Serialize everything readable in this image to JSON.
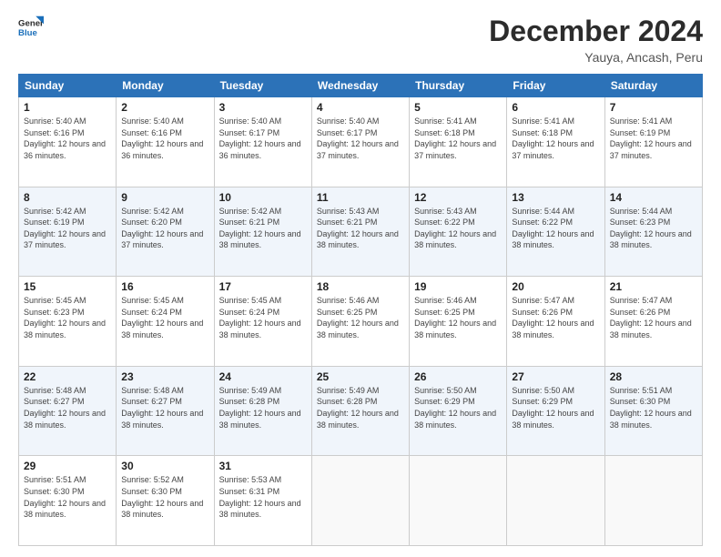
{
  "header": {
    "logo_line1": "General",
    "logo_line2": "Blue",
    "title": "December 2024",
    "subtitle": "Yauya, Ancash, Peru"
  },
  "days_of_week": [
    "Sunday",
    "Monday",
    "Tuesday",
    "Wednesday",
    "Thursday",
    "Friday",
    "Saturday"
  ],
  "weeks": [
    [
      {
        "day": "1",
        "sunrise": "5:40 AM",
        "sunset": "6:16 PM",
        "daylight": "12 hours and 36 minutes."
      },
      {
        "day": "2",
        "sunrise": "5:40 AM",
        "sunset": "6:16 PM",
        "daylight": "12 hours and 36 minutes."
      },
      {
        "day": "3",
        "sunrise": "5:40 AM",
        "sunset": "6:17 PM",
        "daylight": "12 hours and 36 minutes."
      },
      {
        "day": "4",
        "sunrise": "5:40 AM",
        "sunset": "6:17 PM",
        "daylight": "12 hours and 37 minutes."
      },
      {
        "day": "5",
        "sunrise": "5:41 AM",
        "sunset": "6:18 PM",
        "daylight": "12 hours and 37 minutes."
      },
      {
        "day": "6",
        "sunrise": "5:41 AM",
        "sunset": "6:18 PM",
        "daylight": "12 hours and 37 minutes."
      },
      {
        "day": "7",
        "sunrise": "5:41 AM",
        "sunset": "6:19 PM",
        "daylight": "12 hours and 37 minutes."
      }
    ],
    [
      {
        "day": "8",
        "sunrise": "5:42 AM",
        "sunset": "6:19 PM",
        "daylight": "12 hours and 37 minutes."
      },
      {
        "day": "9",
        "sunrise": "5:42 AM",
        "sunset": "6:20 PM",
        "daylight": "12 hours and 37 minutes."
      },
      {
        "day": "10",
        "sunrise": "5:42 AM",
        "sunset": "6:21 PM",
        "daylight": "12 hours and 38 minutes."
      },
      {
        "day": "11",
        "sunrise": "5:43 AM",
        "sunset": "6:21 PM",
        "daylight": "12 hours and 38 minutes."
      },
      {
        "day": "12",
        "sunrise": "5:43 AM",
        "sunset": "6:22 PM",
        "daylight": "12 hours and 38 minutes."
      },
      {
        "day": "13",
        "sunrise": "5:44 AM",
        "sunset": "6:22 PM",
        "daylight": "12 hours and 38 minutes."
      },
      {
        "day": "14",
        "sunrise": "5:44 AM",
        "sunset": "6:23 PM",
        "daylight": "12 hours and 38 minutes."
      }
    ],
    [
      {
        "day": "15",
        "sunrise": "5:45 AM",
        "sunset": "6:23 PM",
        "daylight": "12 hours and 38 minutes."
      },
      {
        "day": "16",
        "sunrise": "5:45 AM",
        "sunset": "6:24 PM",
        "daylight": "12 hours and 38 minutes."
      },
      {
        "day": "17",
        "sunrise": "5:45 AM",
        "sunset": "6:24 PM",
        "daylight": "12 hours and 38 minutes."
      },
      {
        "day": "18",
        "sunrise": "5:46 AM",
        "sunset": "6:25 PM",
        "daylight": "12 hours and 38 minutes."
      },
      {
        "day": "19",
        "sunrise": "5:46 AM",
        "sunset": "6:25 PM",
        "daylight": "12 hours and 38 minutes."
      },
      {
        "day": "20",
        "sunrise": "5:47 AM",
        "sunset": "6:26 PM",
        "daylight": "12 hours and 38 minutes."
      },
      {
        "day": "21",
        "sunrise": "5:47 AM",
        "sunset": "6:26 PM",
        "daylight": "12 hours and 38 minutes."
      }
    ],
    [
      {
        "day": "22",
        "sunrise": "5:48 AM",
        "sunset": "6:27 PM",
        "daylight": "12 hours and 38 minutes."
      },
      {
        "day": "23",
        "sunrise": "5:48 AM",
        "sunset": "6:27 PM",
        "daylight": "12 hours and 38 minutes."
      },
      {
        "day": "24",
        "sunrise": "5:49 AM",
        "sunset": "6:28 PM",
        "daylight": "12 hours and 38 minutes."
      },
      {
        "day": "25",
        "sunrise": "5:49 AM",
        "sunset": "6:28 PM",
        "daylight": "12 hours and 38 minutes."
      },
      {
        "day": "26",
        "sunrise": "5:50 AM",
        "sunset": "6:29 PM",
        "daylight": "12 hours and 38 minutes."
      },
      {
        "day": "27",
        "sunrise": "5:50 AM",
        "sunset": "6:29 PM",
        "daylight": "12 hours and 38 minutes."
      },
      {
        "day": "28",
        "sunrise": "5:51 AM",
        "sunset": "6:30 PM",
        "daylight": "12 hours and 38 minutes."
      }
    ],
    [
      {
        "day": "29",
        "sunrise": "5:51 AM",
        "sunset": "6:30 PM",
        "daylight": "12 hours and 38 minutes."
      },
      {
        "day": "30",
        "sunrise": "5:52 AM",
        "sunset": "6:30 PM",
        "daylight": "12 hours and 38 minutes."
      },
      {
        "day": "31",
        "sunrise": "5:53 AM",
        "sunset": "6:31 PM",
        "daylight": "12 hours and 38 minutes."
      },
      null,
      null,
      null,
      null
    ]
  ]
}
